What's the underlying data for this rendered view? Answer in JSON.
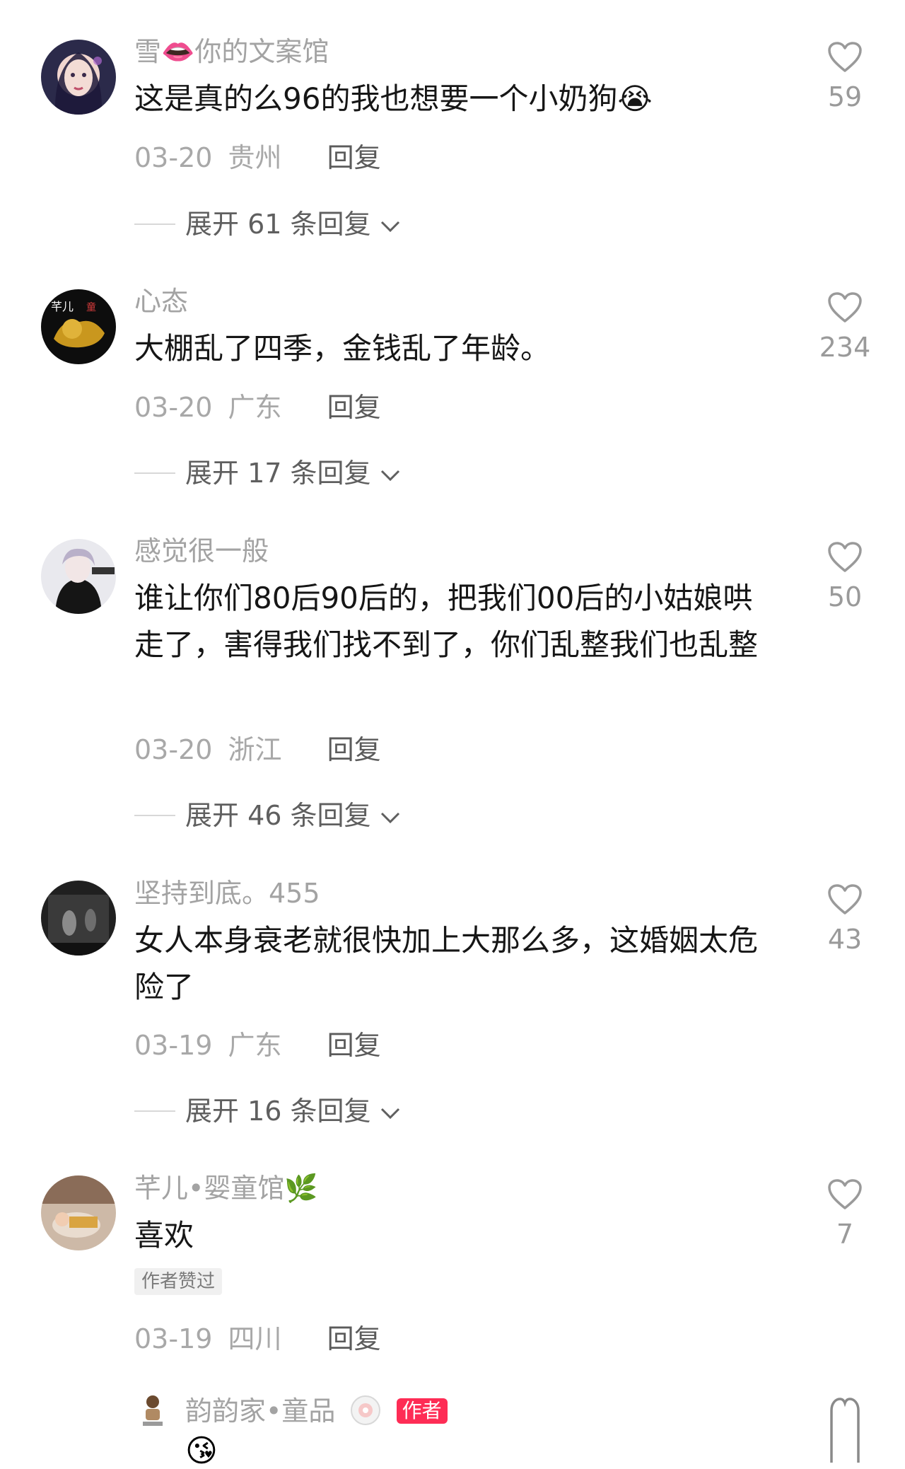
{
  "comments": [
    {
      "username": "雪👄你的文案馆",
      "text": "这是真的么96的我也想要一个小奶狗😭",
      "date": "03-20",
      "region": "贵州",
      "reply_label": "回复",
      "expand_label": "展开 61 条回复",
      "likes": "59"
    },
    {
      "username": "心态",
      "text": "大棚乱了四季，金钱乱了年龄。",
      "date": "03-20",
      "region": "广东",
      "reply_label": "回复",
      "expand_label": "展开 17 条回复",
      "likes": "234"
    },
    {
      "username": "感觉很一般",
      "text": "谁让你们80后90后的，把我们00后的小姑娘哄走了，害得我们找不到了，你们乱整我们也乱整",
      "date": "03-20",
      "region": "浙江",
      "reply_label": "回复",
      "expand_label": "展开 46 条回复",
      "likes": "50"
    },
    {
      "username": "坚持到底。455",
      "text": "女人本身衰老就很快加上大那么多，这婚姻太危险了",
      "date": "03-19",
      "region": "广东",
      "reply_label": "回复",
      "expand_label": "展开 16 条回复",
      "likes": "43"
    },
    {
      "username": "芊儿•婴童馆🌿",
      "text": "喜欢",
      "badge": "作者赞过",
      "date": "03-19",
      "region": "四川",
      "reply_label": "回复",
      "likes": "7"
    }
  ],
  "reply": {
    "username": "韵韵家•童品",
    "author_tag": "作者",
    "emoji": "😘"
  },
  "colors": {
    "text": "#161616",
    "username": "#a3a3a3",
    "meta": "#a8a8a8",
    "author_tag": "#fe2c55"
  },
  "icons": {
    "like": "heart-outline-icon",
    "expand": "chevron-down-icon"
  }
}
